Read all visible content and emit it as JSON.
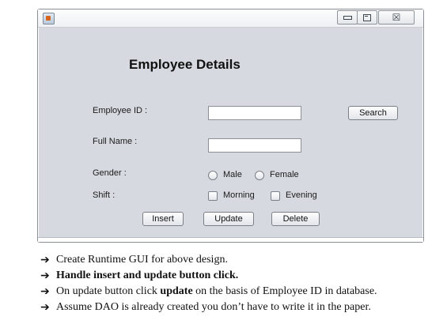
{
  "window": {
    "close_glyph": "☒"
  },
  "form": {
    "title": "Employee Details",
    "employee_id_label": "Employee ID :",
    "full_name_label": "Full Name :",
    "gender_label": "Gender :",
    "shift_label": "Shift :",
    "search_button": "Search",
    "gender_options": [
      "Male",
      "Female"
    ],
    "shift_options": [
      "Morning",
      "Evening"
    ],
    "insert_button": "Insert",
    "update_button": "Update",
    "delete_button": "Delete"
  },
  "notes": {
    "arrow": "➔",
    "items": [
      {
        "pre": "Create Runtime GUI for above design.",
        "bold": "",
        "post": ""
      },
      {
        "pre": "",
        "bold": "Handle insert and update button click.",
        "post": ""
      },
      {
        "pre": "On update button click ",
        "bold": "update",
        "post": " on the basis of Employee ID in database."
      },
      {
        "pre": "Assume DAO is already created you don’t have to write it in the paper.",
        "bold": "",
        "post": ""
      }
    ]
  }
}
